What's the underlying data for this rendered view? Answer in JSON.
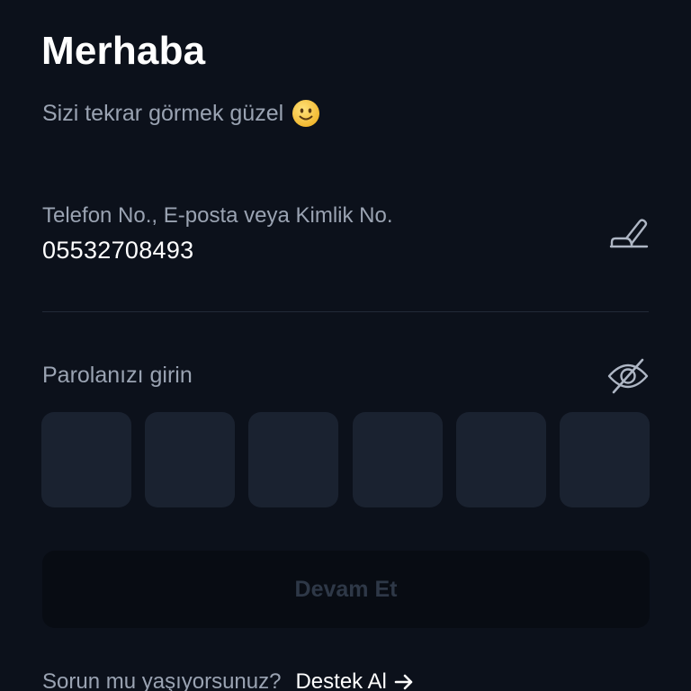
{
  "header": {
    "title": "Merhaba",
    "subtitle": "Sizi tekrar görmek güzel"
  },
  "identity_field": {
    "label": "Telefon No., E-posta veya Kimlik No.",
    "value": "05532708493",
    "edit_icon": "pencil-edit-icon"
  },
  "password": {
    "label": "Parolanızı girin",
    "visibility_icon": "eye-off-icon",
    "pin_length": 6
  },
  "actions": {
    "continue_label": "Devam Et"
  },
  "help": {
    "question": "Sorun mu yaşıyorsunuz?",
    "support_label": "Destek Al"
  },
  "colors": {
    "background": "#0c111b",
    "pin_box": "#1a2230",
    "muted_text": "#9aa3b2",
    "button_disabled_bg": "#080c13",
    "button_disabled_text": "#2e3847",
    "smiley": "#f5c842"
  }
}
